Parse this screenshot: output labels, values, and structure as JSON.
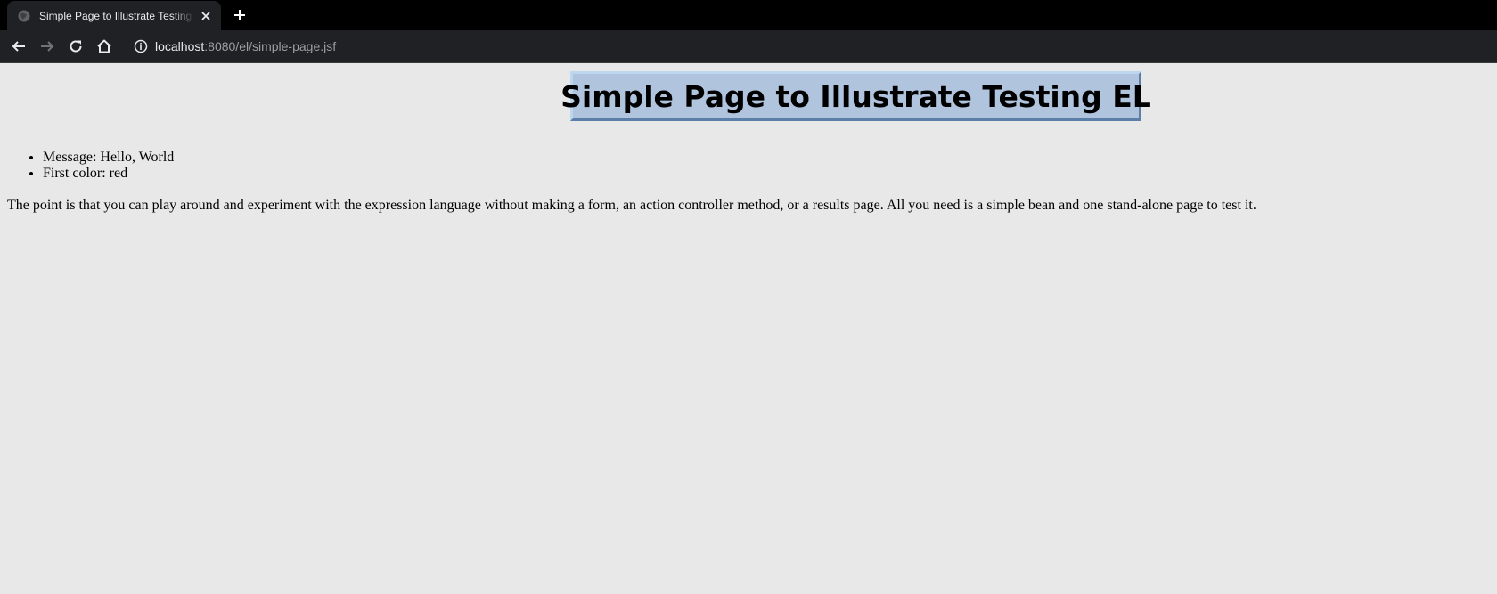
{
  "browser": {
    "tab": {
      "title": "Simple Page to Illustrate Testing EL",
      "favicon": "globe-icon",
      "close_icon": "close-icon"
    },
    "new_tab_icon": "plus-icon",
    "toolbar": {
      "back_icon": "back-arrow-icon",
      "forward_icon": "forward-arrow-icon",
      "reload_icon": "reload-icon",
      "home_icon": "home-icon"
    },
    "address": {
      "info_icon": "info-icon",
      "host": "localhost",
      "path": ":8080/el/simple-page.jsf"
    },
    "colors": {
      "frame": "#000000",
      "toolbar": "#202124",
      "text": "#e8eaed",
      "muted_text": "#9aa0a6"
    }
  },
  "page": {
    "title": "Simple Page to Illustrate Testing EL",
    "title_bg": "#b0c4de",
    "background": "#e8e8e8",
    "items": [
      {
        "label": "Message: Hello, World"
      },
      {
        "label": "First color: red"
      }
    ],
    "explanation": "The point is that you can play around and experiment with the expression language without making a form, an action controller method, or a results page. All you need is a simple bean and one stand-alone page to test it."
  }
}
